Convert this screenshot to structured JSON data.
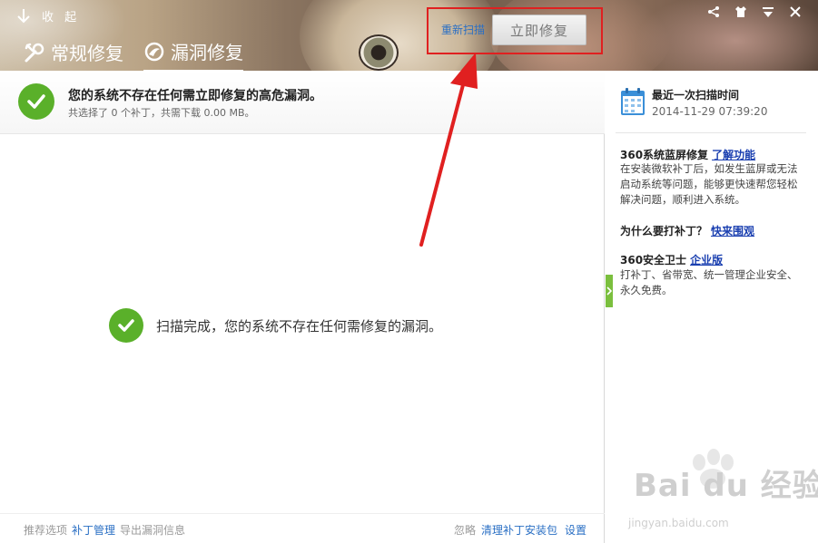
{
  "header": {
    "collapse_label": "收 起",
    "tabs": [
      {
        "label": "常规修复",
        "icon": "wrench-icon",
        "active": false
      },
      {
        "label": "漏洞修复",
        "icon": "shield-icon",
        "active": true
      }
    ],
    "window_controls": [
      "share-icon",
      "skin-icon",
      "menu-icon",
      "close-icon"
    ]
  },
  "status": {
    "title": "您的系统不存在任何需立即修复的高危漏洞。",
    "subtitle": "共选择了 0 个补丁，共需下载 0.00 MB。",
    "rescan_label": "重新扫描",
    "fix_button_label": "立即修复",
    "fix_button_enabled": false
  },
  "result": {
    "message": "扫描完成，您的系统不存在任何需修复的漏洞。"
  },
  "footer": {
    "left": [
      "推荐选项",
      "补丁管理",
      "导出漏洞信息"
    ],
    "right": [
      "忽略",
      "清理补丁安装包",
      "设置"
    ]
  },
  "side": {
    "last_scan_title": "最近一次扫描时间",
    "last_scan_time": "2014-11-29 07:39:20",
    "sections": [
      {
        "heading": "360系统蓝屏修复",
        "link": "了解功能",
        "body": "在安装微软补丁后，如发生蓝屏或无法启动系统等问题，能够更快速帮您轻松解决问题，顺利进入系统。"
      },
      {
        "heading": "为什么要打补丁？",
        "link": "快来围观",
        "body": ""
      },
      {
        "heading": "360安全卫士",
        "link": "企业版",
        "body": "打补丁、省带宽、统一管理企业安全、永久免费。"
      }
    ]
  },
  "watermark": {
    "text": "Bai du 经验",
    "url": "jingyan.baidu.com"
  },
  "colors": {
    "accent_green": "#5ab02a",
    "link_blue": "#2a6fc4",
    "highlight_red": "#e02020"
  }
}
